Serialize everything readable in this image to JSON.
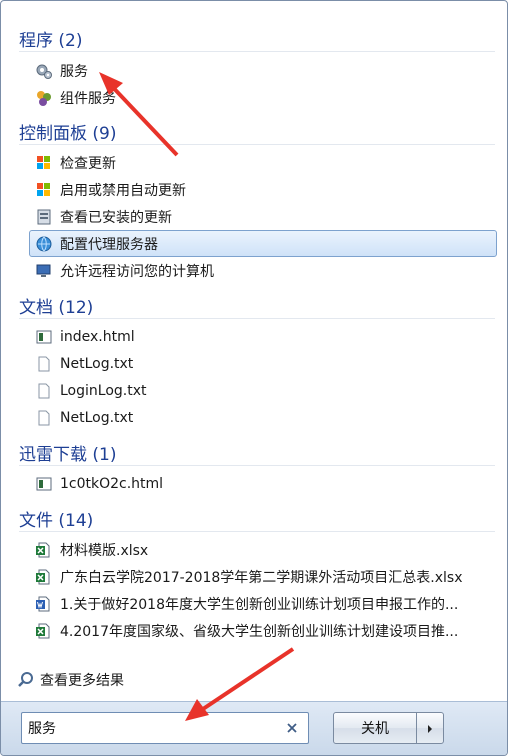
{
  "groups": [
    {
      "header": "程序 (2)",
      "items": [
        {
          "label": "服务",
          "icon": "gears-icon"
        },
        {
          "label": "组件服务",
          "icon": "component-services-icon"
        }
      ]
    },
    {
      "header": "控制面板 (9)",
      "items": [
        {
          "label": "检查更新",
          "icon": "windows-update-icon"
        },
        {
          "label": "启用或禁用自动更新",
          "icon": "windows-update-icon"
        },
        {
          "label": "查看已安装的更新",
          "icon": "installed-updates-icon"
        },
        {
          "label": "配置代理服务器",
          "icon": "internet-options-icon"
        },
        {
          "label": "允许远程访问您的计算机",
          "icon": "remote-access-icon"
        }
      ]
    },
    {
      "header": "文档 (12)",
      "items": [
        {
          "label": "index.html",
          "icon": "html-file-icon"
        },
        {
          "label": "NetLog.txt",
          "icon": "text-file-icon"
        },
        {
          "label": "LoginLog.txt",
          "icon": "text-file-icon"
        },
        {
          "label": "NetLog.txt",
          "icon": "text-file-icon"
        }
      ]
    },
    {
      "header": "迅雷下载 (1)",
      "items": [
        {
          "label": "1c0tkO2c.html",
          "icon": "html-file-icon"
        }
      ]
    },
    {
      "header": "文件 (14)",
      "items": [
        {
          "label": "材料模版.xlsx",
          "icon": "excel-file-icon"
        },
        {
          "label": "广东白云学院2017-2018学年第二学期课外活动项目汇总表.xlsx",
          "icon": "excel-file-icon"
        },
        {
          "label": "1.关于做好2018年度大学生创新创业训练计划项目申报工作的...",
          "icon": "word-file-icon"
        },
        {
          "label": "4.2017年度国家级、省级大学生创新创业训练计划建设项目推...",
          "icon": "excel-file-icon"
        }
      ]
    }
  ],
  "see_more": {
    "label": "查看更多结果",
    "icon": "magnifier-icon"
  },
  "search": {
    "value": "服务",
    "clear_icon": "close-icon"
  },
  "shutdown": {
    "label": "关机",
    "arrow_icon": "arrow-right-icon"
  },
  "colors": {
    "header": "#1e3f94",
    "selected_bg": "#cfe2f8",
    "selected_border": "#7da2ce",
    "annotation": "#e8332a"
  }
}
